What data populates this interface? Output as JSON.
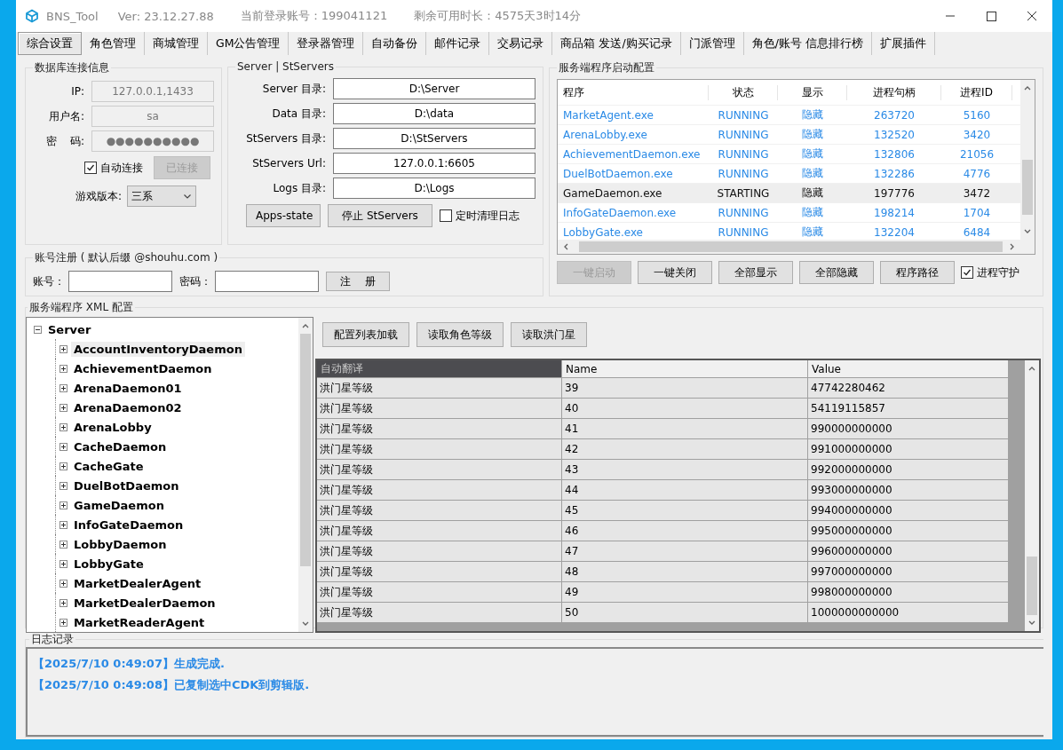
{
  "window": {
    "title": "BNS_Tool",
    "version": "Ver:  23.12.27.88",
    "account": "当前登录账号：199041121",
    "remaining": "剩余可用时长：4575天3时14分"
  },
  "tabs": [
    {
      "label": "综合设置",
      "selected": true
    },
    {
      "label": "角色管理",
      "selected": false
    },
    {
      "label": "商城管理",
      "selected": false
    },
    {
      "label": "GM公告管理",
      "selected": false
    },
    {
      "label": "登录器管理",
      "selected": false
    },
    {
      "label": "自动备份",
      "selected": false
    },
    {
      "label": "邮件记录",
      "selected": false
    },
    {
      "label": "交易记录",
      "selected": false
    },
    {
      "label": "商品箱 发送/购买记录",
      "selected": false
    },
    {
      "label": "门派管理",
      "selected": false
    },
    {
      "label": "角色/账号 信息排行榜",
      "selected": false
    },
    {
      "label": "扩展插件",
      "selected": false
    }
  ],
  "database": {
    "title": "数据库连接信息",
    "fields": [
      {
        "label": "IP:",
        "value": "127.0.0.1,1433",
        "disabled": true
      },
      {
        "label": "用户名:",
        "value": "sa",
        "disabled": true
      },
      {
        "label": "密    码:",
        "value": "●●●●●●●●●●",
        "disabled": true
      }
    ],
    "auto_connect": {
      "label": "自动连接",
      "checked": true
    },
    "connect_button": {
      "label": "已连接",
      "disabled": true
    },
    "game_version": {
      "label": "游戏版本:",
      "value": "三系"
    }
  },
  "servers": {
    "title": "Server | StServers",
    "fields": [
      {
        "label": "Server 目录:",
        "value": "D:\\Server"
      },
      {
        "label": "Data 目录:",
        "value": "D:\\data"
      },
      {
        "label": "StServers 目录:",
        "value": "D:\\StServers"
      },
      {
        "label": "StServers Url:",
        "value": "127.0.0.1:6605"
      },
      {
        "label": "Logs 目录:",
        "value": "D:\\Logs"
      }
    ],
    "buttons": [
      "Apps-state",
      "停止 StServers"
    ],
    "clean_logs": {
      "label": "定时清理日志",
      "checked": false
    }
  },
  "register": {
    "title": "账号注册 ( 默认后缀 @shouhu.com )",
    "account_label": "账号：",
    "password_label": "密码：",
    "button": "注    册"
  },
  "process_config": {
    "title": "服务端程序启动配置",
    "columns": [
      "程序",
      "状态",
      "显示",
      "进程句柄",
      "进程ID"
    ],
    "rows": [
      {
        "cells": [
          "MarketAgent.exe",
          "RUNNING",
          "隐藏",
          "263720",
          "5160"
        ],
        "selected": false
      },
      {
        "cells": [
          "ArenaLobby.exe",
          "RUNNING",
          "隐藏",
          "132520",
          "3420"
        ],
        "selected": false
      },
      {
        "cells": [
          "AchievementDaemon.exe",
          "RUNNING",
          "隐藏",
          "132806",
          "21056"
        ],
        "selected": false
      },
      {
        "cells": [
          "DuelBotDaemon.exe",
          "RUNNING",
          "隐藏",
          "132286",
          "4776"
        ],
        "selected": false
      },
      {
        "cells": [
          "GameDaemon.exe",
          "STARTING",
          "隐藏",
          "197776",
          "3472"
        ],
        "selected": true
      },
      {
        "cells": [
          "InfoGateDaemon.exe",
          "RUNNING",
          "隐藏",
          "198214",
          "1704"
        ],
        "selected": false
      },
      {
        "cells": [
          "LobbyGate.exe",
          "RUNNING",
          "隐藏",
          "132204",
          "6484"
        ],
        "selected": false
      }
    ],
    "buttons": [
      {
        "label": "一键启动",
        "disabled": true
      },
      {
        "label": "一键关闭",
        "disabled": false
      },
      {
        "label": "全部显示",
        "disabled": false
      },
      {
        "label": "全部隐藏",
        "disabled": false
      },
      {
        "label": "程序路径",
        "disabled": false
      }
    ],
    "guard": {
      "label": "进程守护",
      "checked": true
    }
  },
  "xml_config": {
    "title": "服务端程序 XML 配置",
    "tree": {
      "label": "Server",
      "expanded": true,
      "children": [
        {
          "label": "AccountInventoryDaemon",
          "expanded": false,
          "selected": true
        },
        {
          "label": "AchievementDaemon",
          "expanded": false,
          "selected": false
        },
        {
          "label": "ArenaDaemon01",
          "expanded": false,
          "selected": false
        },
        {
          "label": "ArenaDaemon02",
          "expanded": false,
          "selected": false
        },
        {
          "label": "ArenaLobby",
          "expanded": false,
          "selected": false
        },
        {
          "label": "CacheDaemon",
          "expanded": false,
          "selected": false
        },
        {
          "label": "CacheGate",
          "expanded": false,
          "selected": false
        },
        {
          "label": "DuelBotDaemon",
          "expanded": false,
          "selected": false
        },
        {
          "label": "GameDaemon",
          "expanded": false,
          "selected": false
        },
        {
          "label": "InfoGateDaemon",
          "expanded": false,
          "selected": false
        },
        {
          "label": "LobbyDaemon",
          "expanded": false,
          "selected": false
        },
        {
          "label": "LobbyGate",
          "expanded": false,
          "selected": false
        },
        {
          "label": "MarketDealerAgent",
          "expanded": false,
          "selected": false
        },
        {
          "label": "MarketDealerDaemon",
          "expanded": false,
          "selected": false
        },
        {
          "label": "MarketReaderAgent",
          "expanded": false,
          "selected": false
        }
      ]
    },
    "buttons": [
      "配置列表加载",
      "读取角色等级",
      "读取洪门星"
    ],
    "grid": {
      "columns": [
        {
          "label": "自动翻译",
          "selected": true
        },
        {
          "label": "Name",
          "selected": false
        },
        {
          "label": "Value",
          "selected": false
        }
      ],
      "rows": [
        [
          "洪门星等级",
          "39",
          "47742280462"
        ],
        [
          "洪门星等级",
          "40",
          "54119115857"
        ],
        [
          "洪门星等级",
          "41",
          "990000000000"
        ],
        [
          "洪门星等级",
          "42",
          "991000000000"
        ],
        [
          "洪门星等级",
          "43",
          "992000000000"
        ],
        [
          "洪门星等级",
          "44",
          "993000000000"
        ],
        [
          "洪门星等级",
          "45",
          "994000000000"
        ],
        [
          "洪门星等级",
          "46",
          "995000000000"
        ],
        [
          "洪门星等级",
          "47",
          "996000000000"
        ],
        [
          "洪门星等级",
          "48",
          "997000000000"
        ],
        [
          "洪门星等级",
          "49",
          "998000000000"
        ],
        [
          "洪门星等级",
          "50",
          "1000000000000"
        ]
      ]
    }
  },
  "log": {
    "title": "日志记录",
    "entries": [
      "【2025/7/10 0:49:07】生成完成.",
      "【2025/7/10 0:49:08】已复制选中CDK到剪辑版."
    ]
  }
}
